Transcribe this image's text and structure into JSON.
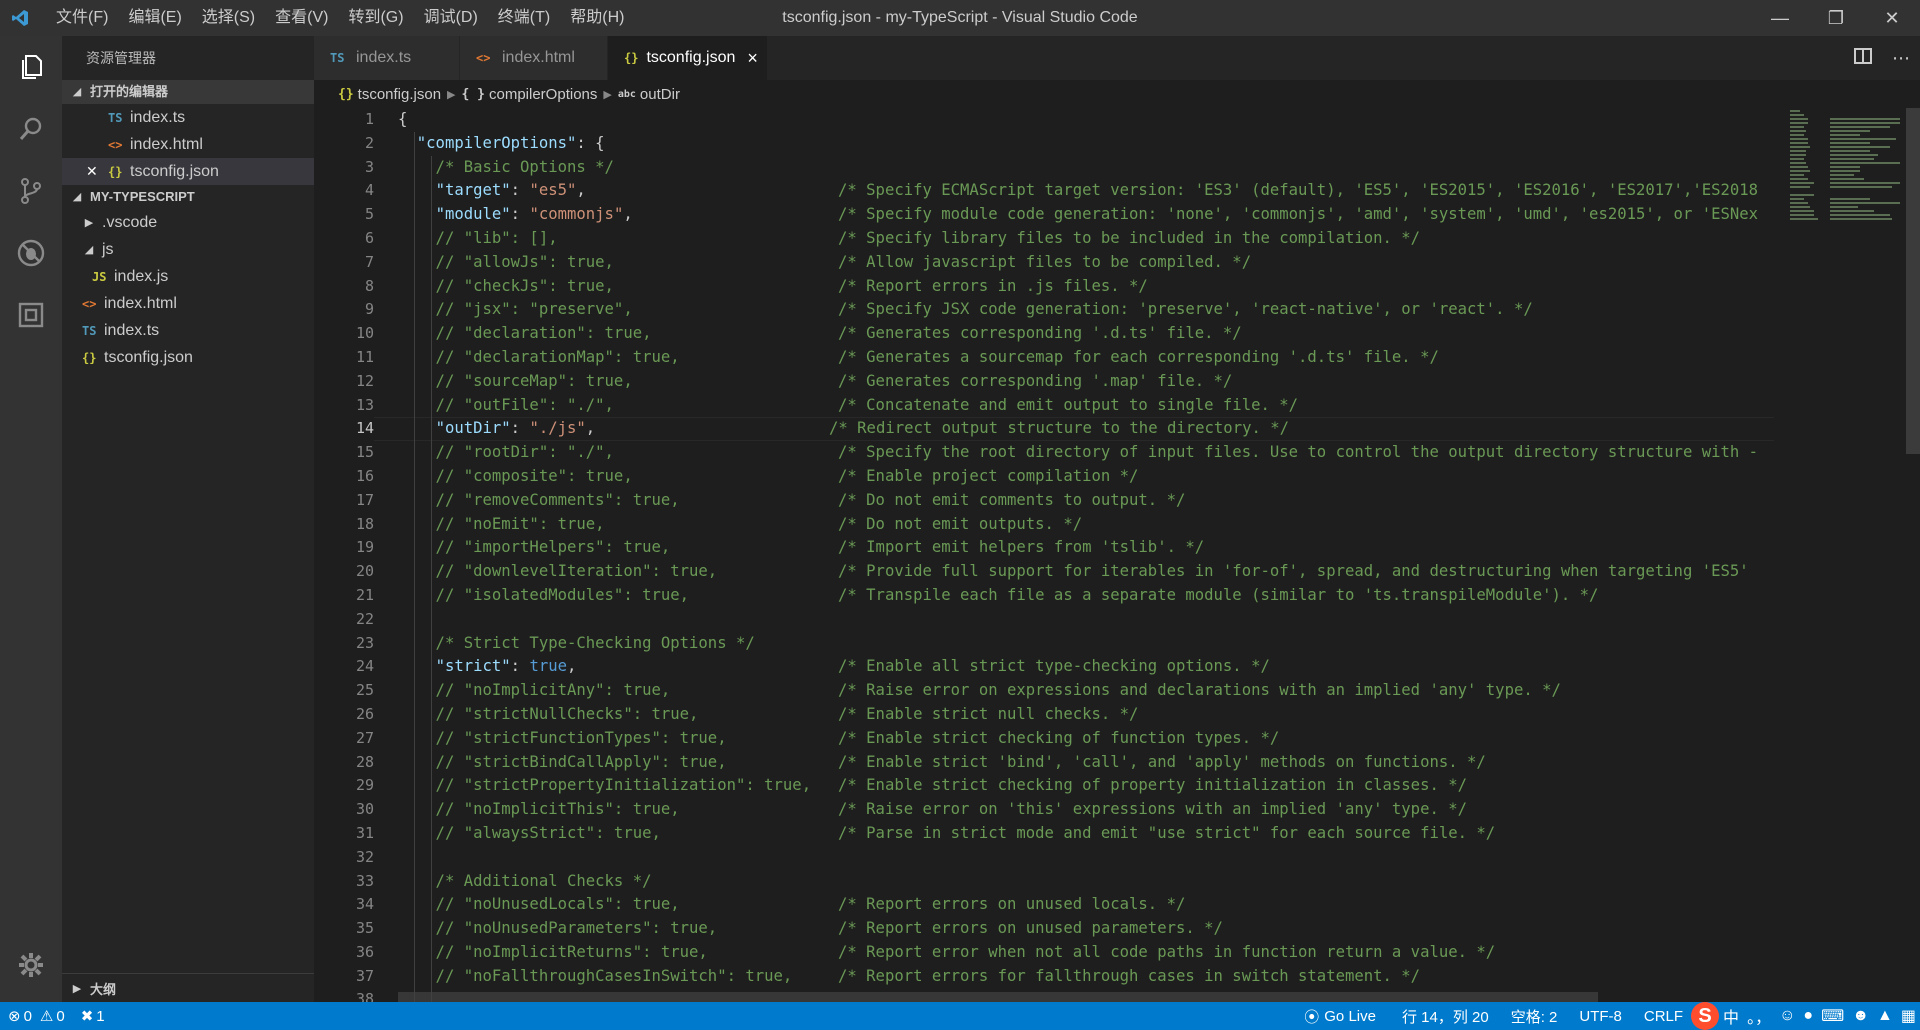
{
  "titlebar": {
    "menu": [
      "文件(F)",
      "编辑(E)",
      "选择(S)",
      "查看(V)",
      "转到(G)",
      "调试(D)",
      "终端(T)",
      "帮助(H)"
    ],
    "title": "tsconfig.json - my-TypeScript - Visual Studio Code"
  },
  "sidebar": {
    "title": "资源管理器",
    "open_editors": {
      "label": "打开的编辑器",
      "items": [
        {
          "icon": "TS",
          "name": "index.ts"
        },
        {
          "icon": "<>",
          "name": "index.html"
        },
        {
          "icon": "{}",
          "name": "tsconfig.json"
        }
      ]
    },
    "project": {
      "label": "MY-TYPESCRIPT",
      "items": [
        {
          "name": ".vscode"
        },
        {
          "name": "js"
        },
        {
          "icon": "JS",
          "name": "index.js"
        },
        {
          "icon": "<>",
          "name": "index.html"
        },
        {
          "icon": "TS",
          "name": "index.ts"
        },
        {
          "icon": "{}",
          "name": "tsconfig.json"
        }
      ]
    },
    "outline_label": "大纲"
  },
  "tabs": [
    {
      "icon": "TS",
      "label": "index.ts"
    },
    {
      "icon": "<>",
      "label": "index.html"
    },
    {
      "icon": "{}",
      "label": "tsconfig.json",
      "close": "×"
    }
  ],
  "breadcrumb": {
    "file": "tsconfig.json",
    "object": "compilerOptions",
    "property": "outDir",
    "object_icon": "{ }",
    "property_icon": "abc"
  },
  "code": {
    "current_line": 14,
    "lines": [
      {
        "n": 1,
        "t": "{"
      },
      {
        "n": 2,
        "t": "  \"compilerOptions\": {"
      },
      {
        "n": 3,
        "t": "    /* Basic Options */"
      },
      {
        "n": 4,
        "t": "    \"target\": \"es5\",",
        "c": "/* Specify ECMAScript target version: 'ES3' (default), 'ES5', 'ES2015', 'ES2016', 'ES2017','ES2018"
      },
      {
        "n": 5,
        "t": "    \"module\": \"commonjs\",",
        "c": "/* Specify module code generation: 'none', 'commonjs', 'amd', 'system', 'umd', 'es2015', or 'ESNex"
      },
      {
        "n": 6,
        "t": "    // \"lib\": [],",
        "c": "/* Specify library files to be included in the compilation. */"
      },
      {
        "n": 7,
        "t": "    // \"allowJs\": true,",
        "c": "/* Allow javascript files to be compiled. */"
      },
      {
        "n": 8,
        "t": "    // \"checkJs\": true,",
        "c": "/* Report errors in .js files. */"
      },
      {
        "n": 9,
        "t": "    // \"jsx\": \"preserve\",",
        "c": "/* Specify JSX code generation: 'preserve', 'react-native', or 'react'. */"
      },
      {
        "n": 10,
        "t": "    // \"declaration\": true,",
        "c": "/* Generates corresponding '.d.ts' file. */"
      },
      {
        "n": 11,
        "t": "    // \"declarationMap\": true,",
        "c": "/* Generates a sourcemap for each corresponding '.d.ts' file. */"
      },
      {
        "n": 12,
        "t": "    // \"sourceMap\": true,",
        "c": "/* Generates corresponding '.map' file. */"
      },
      {
        "n": 13,
        "t": "    // \"outFile\": \"./\",",
        "c": "/* Concatenate and emit output to single file. */"
      },
      {
        "n": 14,
        "t": "    \"outDir\": \"./js\",",
        "c": "/* Redirect output structure to the directory. */"
      },
      {
        "n": 15,
        "t": "    // \"rootDir\": \"./\",",
        "c": "/* Specify the root directory of input files. Use to control the output directory structure with -"
      },
      {
        "n": 16,
        "t": "    // \"composite\": true,",
        "c": "/* Enable project compilation */"
      },
      {
        "n": 17,
        "t": "    // \"removeComments\": true,",
        "c": "/* Do not emit comments to output. */"
      },
      {
        "n": 18,
        "t": "    // \"noEmit\": true,",
        "c": "/* Do not emit outputs. */"
      },
      {
        "n": 19,
        "t": "    // \"importHelpers\": true,",
        "c": "/* Import emit helpers from 'tslib'. */"
      },
      {
        "n": 20,
        "t": "    // \"downlevelIteration\": true,",
        "c": "/* Provide full support for iterables in 'for-of', spread, and destructuring when targeting 'ES5'"
      },
      {
        "n": 21,
        "t": "    // \"isolatedModules\": true,",
        "c": "/* Transpile each file as a separate module (similar to 'ts.transpileModule'). */"
      },
      {
        "n": 22,
        "t": ""
      },
      {
        "n": 23,
        "t": "    /* Strict Type-Checking Options */"
      },
      {
        "n": 24,
        "t": "    \"strict\": true,",
        "c": "/* Enable all strict type-checking options. */"
      },
      {
        "n": 25,
        "t": "    // \"noImplicitAny\": true,",
        "c": "/* Raise error on expressions and declarations with an implied 'any' type. */"
      },
      {
        "n": 26,
        "t": "    // \"strictNullChecks\": true,",
        "c": "/* Enable strict null checks. */"
      },
      {
        "n": 27,
        "t": "    // \"strictFunctionTypes\": true,",
        "c": "/* Enable strict checking of function types. */"
      },
      {
        "n": 28,
        "t": "    // \"strictBindCallApply\": true,",
        "c": "/* Enable strict 'bind', 'call', and 'apply' methods on functions. */"
      },
      {
        "n": 29,
        "t": "    // \"strictPropertyInitialization\": true,",
        "c": "/* Enable strict checking of property initialization in classes. */"
      },
      {
        "n": 30,
        "t": "    // \"noImplicitThis\": true,",
        "c": "/* Raise error on 'this' expressions with an implied 'any' type. */"
      },
      {
        "n": 31,
        "t": "    // \"alwaysStrict\": true,",
        "c": "/* Parse in strict mode and emit \"use strict\" for each source file. */"
      },
      {
        "n": 32,
        "t": ""
      },
      {
        "n": 33,
        "t": "    /* Additional Checks */"
      },
      {
        "n": 34,
        "t": "    // \"noUnusedLocals\": true,",
        "c": "/* Report errors on unused locals. */"
      },
      {
        "n": 35,
        "t": "    // \"noUnusedParameters\": true,",
        "c": "/* Report errors on unused parameters. */"
      },
      {
        "n": 36,
        "t": "    // \"noImplicitReturns\": true,",
        "c": "/* Report error when not all code paths in function return a value. */"
      },
      {
        "n": 37,
        "t": "    // \"noFallthroughCasesInSwitch\": true,",
        "c": "/* Report errors for fallthrough cases in switch statement. */"
      },
      {
        "n": 38,
        "t": ""
      }
    ]
  },
  "statusbar": {
    "errors": "0",
    "warnings": "0",
    "conflicts": "1",
    "go_live": "Go Live",
    "position": "行 14，列 20",
    "spaces": "空格: 2",
    "encoding": "UTF-8",
    "eol": "CRLF",
    "ime_lang": "中"
  },
  "colors": {
    "accent": "#007acc",
    "editor_bg": "#1e1e1e",
    "sidebar_bg": "#252526"
  }
}
